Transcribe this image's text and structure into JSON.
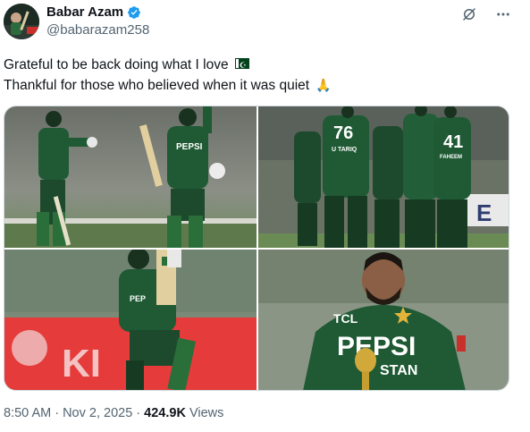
{
  "author": {
    "name": "Babar Azam",
    "handle": "@babarazam258",
    "verified_color": "#1d9bf0"
  },
  "post": {
    "line1": "Grateful to be back doing what I love",
    "line2": "Thankful for those who believed when it was quiet",
    "line1_emoji": "pakistan-flag",
    "line2_emoji": "folded-hands",
    "timestamp": "8:50 AM · Nov 2, 2025",
    "separator": " · ",
    "views_count": "424.9K",
    "views_label": " Views"
  },
  "photos": [
    {
      "name": "photo-batting-celebration",
      "jersey_text": "PEPSI"
    },
    {
      "name": "photo-team-huddle",
      "numbers": [
        "76",
        "41"
      ],
      "names": [
        "U TARIQ",
        "FAHEEM"
      ]
    },
    {
      "name": "photo-bat-raised",
      "banner_text": "KI"
    },
    {
      "name": "photo-trophy-portrait",
      "sponsor": "TCL",
      "jersey_text": "PEPSI",
      "jersey_sub": "STAN"
    }
  ],
  "colors": {
    "jersey_green": "#1f5a34",
    "accent_text": "#0f1419",
    "muted_text": "#536471"
  }
}
